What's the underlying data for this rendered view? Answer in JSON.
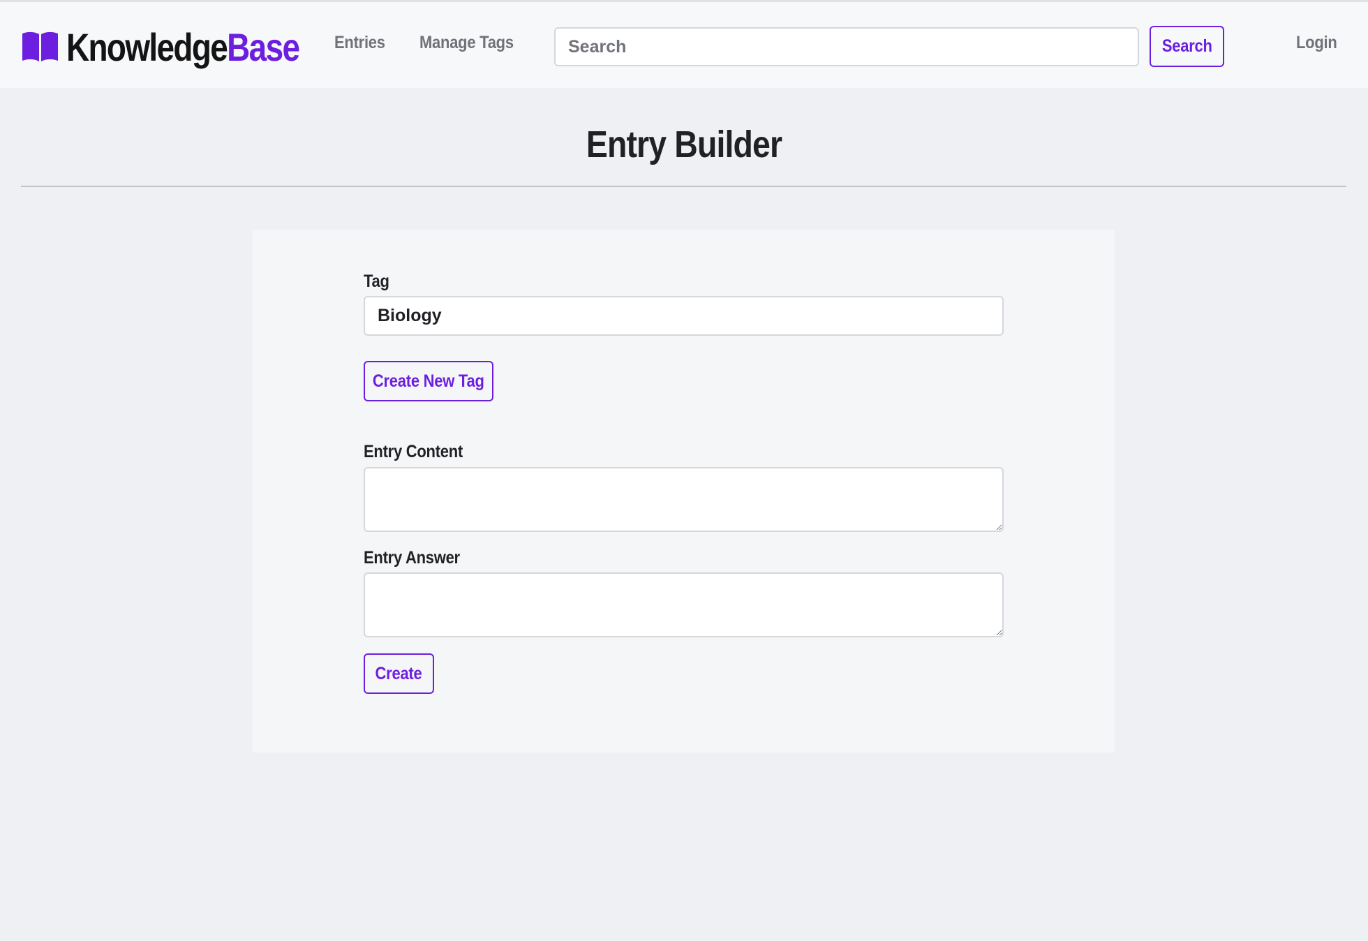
{
  "brand": {
    "name_part1": "Knowledge",
    "name_part2": "Base",
    "icon": "open-book-icon",
    "accent_color": "#6d1fe0"
  },
  "nav": {
    "entries_label": "Entries",
    "manage_tags_label": "Manage Tags",
    "search_placeholder": "Search",
    "search_value": "",
    "search_button_label": "Search",
    "login_label": "Login"
  },
  "page": {
    "title": "Entry Builder"
  },
  "form": {
    "tag_label": "Tag",
    "tag_value": "Biology",
    "create_tag_button_label": "Create New Tag",
    "entry_content_label": "Entry Content",
    "entry_content_value": "",
    "entry_answer_label": "Entry Answer",
    "entry_answer_value": "",
    "create_button_label": "Create"
  }
}
